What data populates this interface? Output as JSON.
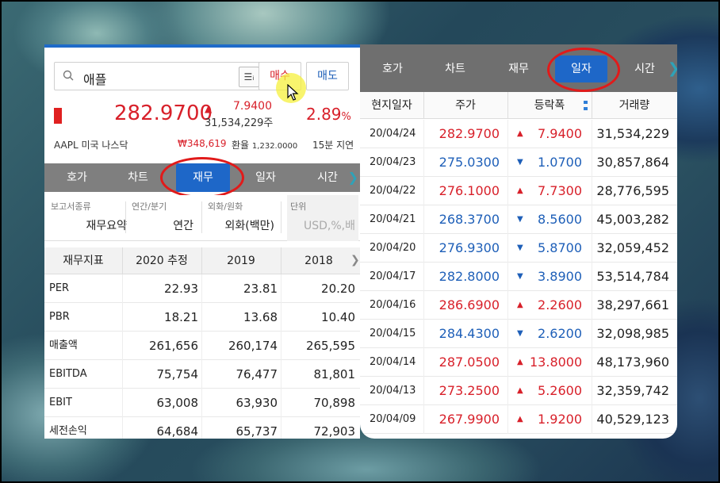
{
  "left": {
    "search": {
      "value": "애플",
      "list_icon": "list-icon"
    },
    "buttons": {
      "buy": "매수",
      "sell": "매도"
    },
    "quote": {
      "price": "282.9700",
      "direction_icon": "▲",
      "change": "7.9400",
      "volume": "31,534,229주",
      "rate": "2.89",
      "rate_unit": "%"
    },
    "info": {
      "code": "AAPL  미국 나스닥",
      "krw": "₩348,619",
      "fx_label": "환율",
      "fx_value": "1,232.0000",
      "delay": "15분 지연"
    },
    "tabs": [
      "호가",
      "차트",
      "재무",
      "일자",
      "시간"
    ],
    "filters": [
      {
        "label": "보고서종류",
        "value": "재무요약"
      },
      {
        "label": "연간/분기",
        "value": "연간"
      },
      {
        "label": "외화/원화",
        "value": "외화(백만)"
      },
      {
        "label": "단위",
        "value": "USD,%,배"
      }
    ],
    "table": {
      "headers": [
        "재무지표",
        "2020 추정",
        "2019",
        "2018"
      ],
      "rows": [
        {
          "name": "PER",
          "values": [
            "22.93",
            "23.81",
            "20.20"
          ]
        },
        {
          "name": "PBR",
          "values": [
            "18.21",
            "13.68",
            "10.40"
          ]
        },
        {
          "name": "매출액",
          "values": [
            "261,656",
            "260,174",
            "265,595"
          ]
        },
        {
          "name": "EBITDA",
          "values": [
            "75,754",
            "76,477",
            "81,801"
          ]
        },
        {
          "name": "EBIT",
          "values": [
            "63,008",
            "63,930",
            "70,898"
          ]
        },
        {
          "name": "세전손익",
          "values": [
            "64,684",
            "65,737",
            "72,903"
          ]
        }
      ]
    }
  },
  "right": {
    "tabs": [
      "호가",
      "차트",
      "재무",
      "일자",
      "시간"
    ],
    "headers": [
      "현지일자",
      "주가",
      "등락폭",
      "거래량"
    ],
    "rows": [
      {
        "date": "20/04/24",
        "price": "282.9700",
        "dir": "▲",
        "change": "7.9400",
        "volume": "31,534,229"
      },
      {
        "date": "20/04/23",
        "price": "275.0300",
        "dir": "▼",
        "change": "1.0700",
        "volume": "30,857,864"
      },
      {
        "date": "20/04/22",
        "price": "276.1000",
        "dir": "▲",
        "change": "7.7300",
        "volume": "28,776,595"
      },
      {
        "date": "20/04/21",
        "price": "268.3700",
        "dir": "▼",
        "change": "8.5600",
        "volume": "45,003,282"
      },
      {
        "date": "20/04/20",
        "price": "276.9300",
        "dir": "▼",
        "change": "5.8700",
        "volume": "32,059,452"
      },
      {
        "date": "20/04/17",
        "price": "282.8000",
        "dir": "▼",
        "change": "3.8900",
        "volume": "53,514,784"
      },
      {
        "date": "20/04/16",
        "price": "286.6900",
        "dir": "▲",
        "change": "2.2600",
        "volume": "38,297,661"
      },
      {
        "date": "20/04/15",
        "price": "284.4300",
        "dir": "▼",
        "change": "2.6200",
        "volume": "32,098,985"
      },
      {
        "date": "20/04/14",
        "price": "287.0500",
        "dir": "▲",
        "change": "13.8000",
        "volume": "48,173,960"
      },
      {
        "date": "20/04/13",
        "price": "273.2500",
        "dir": "▲",
        "change": "5.2600",
        "volume": "32,359,742"
      },
      {
        "date": "20/04/09",
        "price": "267.9900",
        "dir": "▲",
        "change": "1.9200",
        "volume": "40,529,123"
      }
    ]
  },
  "colors": {
    "up": "#d8202a",
    "down": "#1e5fb8",
    "active_tab": "#1e67c8",
    "highlight": "#e11a1a"
  }
}
